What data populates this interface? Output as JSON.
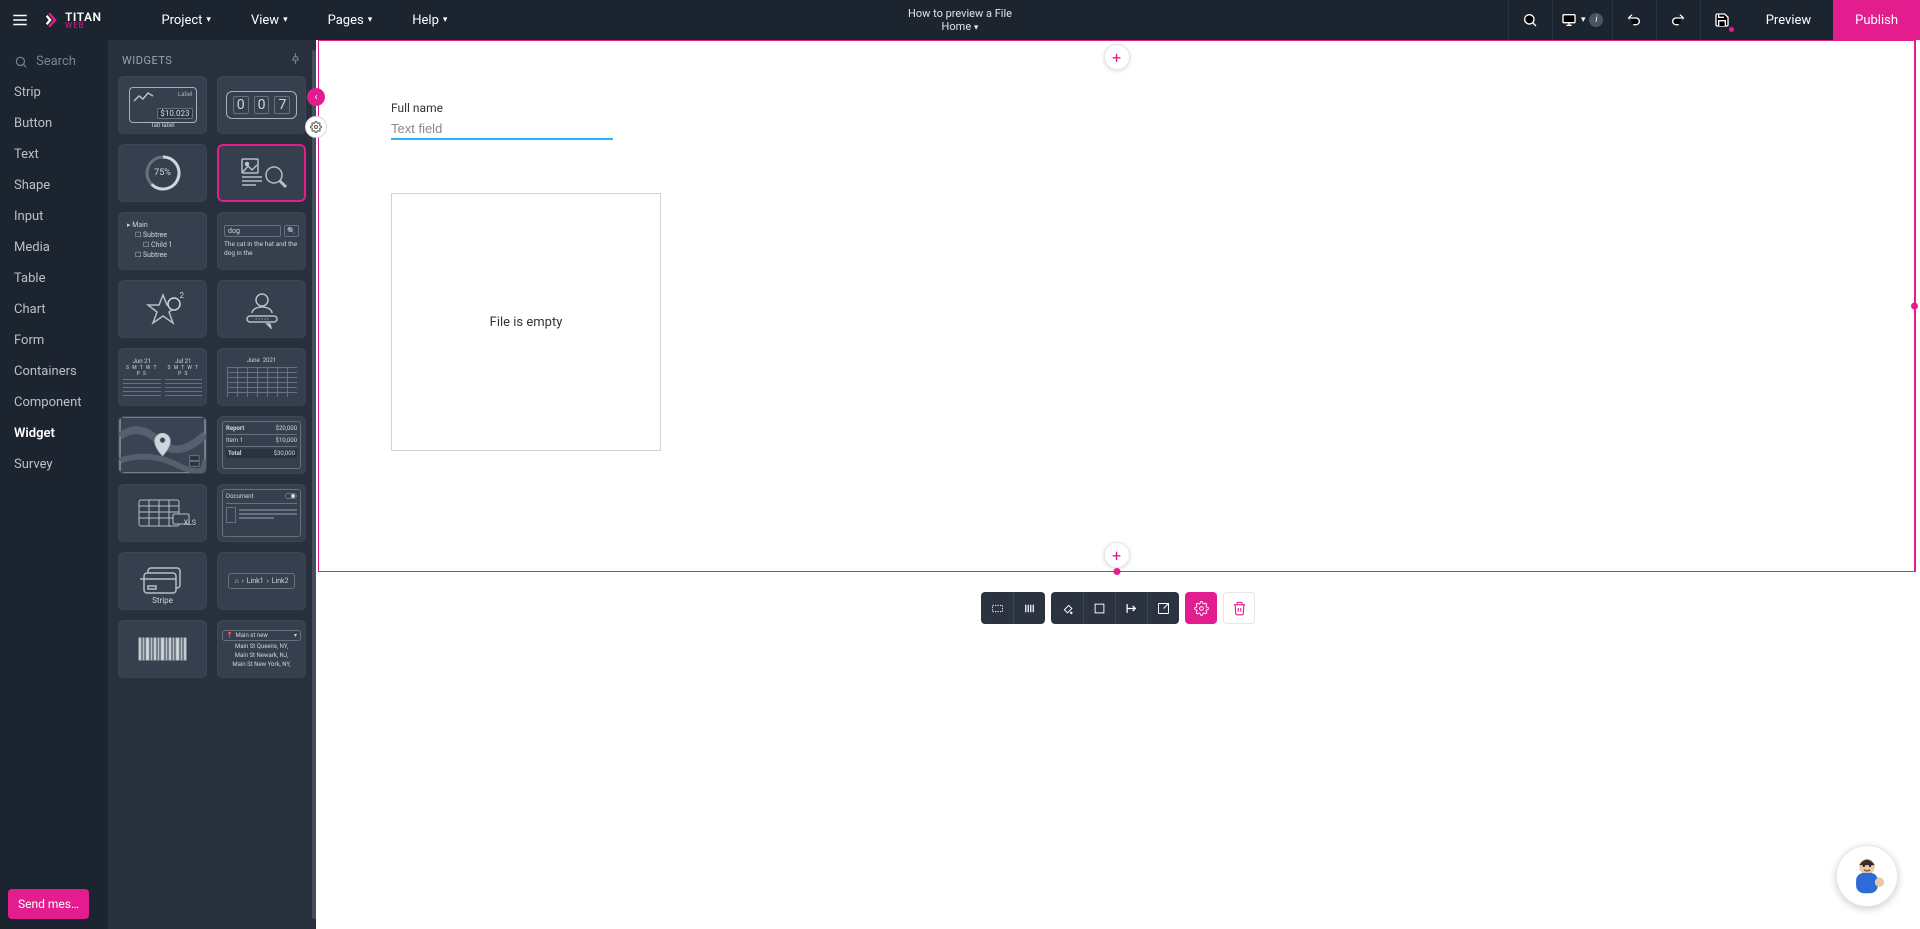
{
  "brand": {
    "name": "TITAN",
    "subline": "WEB"
  },
  "menu": {
    "project": "Project",
    "view": "View",
    "pages": "Pages",
    "help": "Help"
  },
  "headerCenter": {
    "title": "How to preview a File",
    "page": "Home"
  },
  "headerRight": {
    "preview": "Preview",
    "publish": "Publish"
  },
  "search": {
    "placeholder": "Search"
  },
  "nav": {
    "strip": "Strip",
    "button": "Button",
    "text": "Text",
    "shape": "Shape",
    "input": "Input",
    "media": "Media",
    "table": "Table",
    "chart": "Chart",
    "form": "Form",
    "containers": "Containers",
    "component": "Component",
    "widget": "Widget",
    "survey": "Survey"
  },
  "panel": {
    "title": "WIDGETS"
  },
  "widgets": {
    "kpi_label": "Label",
    "kpi_value": "$10.023",
    "kpi_tab": "Tab label",
    "counter": {
      "d1": "0",
      "d2": "0",
      "d3": "7"
    },
    "progress": "75%",
    "tree": {
      "main": "Main",
      "sub1": "Subtree",
      "child1": "Child 1",
      "sub2": "Subtree"
    },
    "wordsearch": {
      "query": "dog",
      "line": "The cat in the hat and the dog in the"
    },
    "rating": "2",
    "datepicker": {
      "m1": "Jun 21",
      "m2": "Jul 21",
      "days": "S M T W T P S"
    },
    "calendar": {
      "month": "June",
      "year": "2021"
    },
    "report": {
      "title": "Report",
      "a": "$20,000",
      "item1": "Item 1",
      "b": "$10,000",
      "total": "Total",
      "tval": "$30,000"
    },
    "xls": "XLS",
    "document": "Document",
    "stripe": "Stripe",
    "breadcrumb": {
      "l1": "Link1",
      "l2": "Link2"
    },
    "address": {
      "main": "Main st new",
      "a1": "Main St Queens, NY,",
      "a2": "Main St Newark, NJ,",
      "a3": "Main St New York, NY,"
    }
  },
  "canvas": {
    "fieldLabel": "Full name",
    "fieldPlaceholder": "Text field",
    "fileEmpty": "File is empty"
  },
  "sendMessage": "Send mes…"
}
